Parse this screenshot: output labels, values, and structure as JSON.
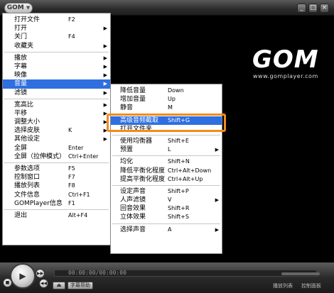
{
  "titlebar": {
    "logo": "GOM",
    "logo_arrow": "▼",
    "min": "_",
    "max": "□",
    "close": "×"
  },
  "brand": {
    "logo": "GOM",
    "url": "www.gomplayer.com"
  },
  "main_menu": [
    {
      "label": "打开文件",
      "shortcut": "F2"
    },
    {
      "label": "打开",
      "shortcut": "",
      "sub": true
    },
    {
      "label": "关门",
      "shortcut": "F4"
    },
    {
      "label": "收藏夹",
      "shortcut": "",
      "sub": true
    },
    {
      "sep": true
    },
    {
      "label": "播放",
      "shortcut": "",
      "sub": true
    },
    {
      "label": "字幕",
      "shortcut": "",
      "sub": true
    },
    {
      "label": "映像",
      "shortcut": "",
      "sub": true
    },
    {
      "label": "音量",
      "shortcut": "",
      "sub": true,
      "highlight": true
    },
    {
      "label": "滤镜",
      "shortcut": "",
      "sub": true
    },
    {
      "sep": true
    },
    {
      "label": "宽高比",
      "shortcut": "",
      "sub": true
    },
    {
      "label": "平移",
      "shortcut": "",
      "sub": true
    },
    {
      "label": "调整大小",
      "shortcut": "",
      "sub": true
    },
    {
      "label": "选择皮肤",
      "shortcut": "K",
      "sub": true
    },
    {
      "label": "其他设定",
      "shortcut": "",
      "sub": true
    },
    {
      "label": "全屏",
      "shortcut": "Enter"
    },
    {
      "label": "全屏（拉伸模式）",
      "shortcut": "Ctrl+Enter"
    },
    {
      "sep": true
    },
    {
      "label": "参数选项",
      "shortcut": "F5"
    },
    {
      "label": "控制窗口",
      "shortcut": "F7"
    },
    {
      "label": "播放列表",
      "shortcut": "F8"
    },
    {
      "label": "文件信息",
      "shortcut": "Ctrl+F1"
    },
    {
      "label": "GOMPlayer信息",
      "shortcut": "F1"
    },
    {
      "sep": true
    },
    {
      "label": "退出",
      "shortcut": "Alt+F4"
    }
  ],
  "sub_menu": [
    {
      "label": "降低音量",
      "shortcut": "Down"
    },
    {
      "label": "增加音量",
      "shortcut": "Up"
    },
    {
      "label": "静音",
      "shortcut": "M"
    },
    {
      "sep": true
    },
    {
      "label": "高级音频截取",
      "shortcut": "Shift+G",
      "highlight": true
    },
    {
      "label": "打开文件夹",
      "shortcut": ""
    },
    {
      "sep": true
    },
    {
      "label": "使用均衡器",
      "shortcut": "Shift+E"
    },
    {
      "label": "预置",
      "shortcut": "L",
      "sub": true
    },
    {
      "sep": true
    },
    {
      "label": "均化",
      "shortcut": "Shift+N"
    },
    {
      "label": "降低平衡化程度",
      "shortcut": "Ctrl+Alt+Down"
    },
    {
      "label": "提高平衡化程度",
      "shortcut": "Ctrl+Alt+Up"
    },
    {
      "sep": true
    },
    {
      "label": "设定声音",
      "shortcut": "Shift+P"
    },
    {
      "label": "人声滤镜",
      "shortcut": "V",
      "sub": true
    },
    {
      "label": "回音效果",
      "shortcut": "Shift+R"
    },
    {
      "label": "立体效果",
      "shortcut": "Shift+S"
    },
    {
      "sep": true
    },
    {
      "label": "选择声音",
      "shortcut": "A",
      "sub": true
    }
  ],
  "controls": {
    "play": "▶",
    "time": "00:00:00/00:00:00",
    "eject": "⏏",
    "subtitle_button": "字幕帮助",
    "playlist_label": "播放列表",
    "control_label": "控制面板"
  },
  "colors": {
    "highlight": "#2f6fe0",
    "annotation": "#f28c1c"
  }
}
